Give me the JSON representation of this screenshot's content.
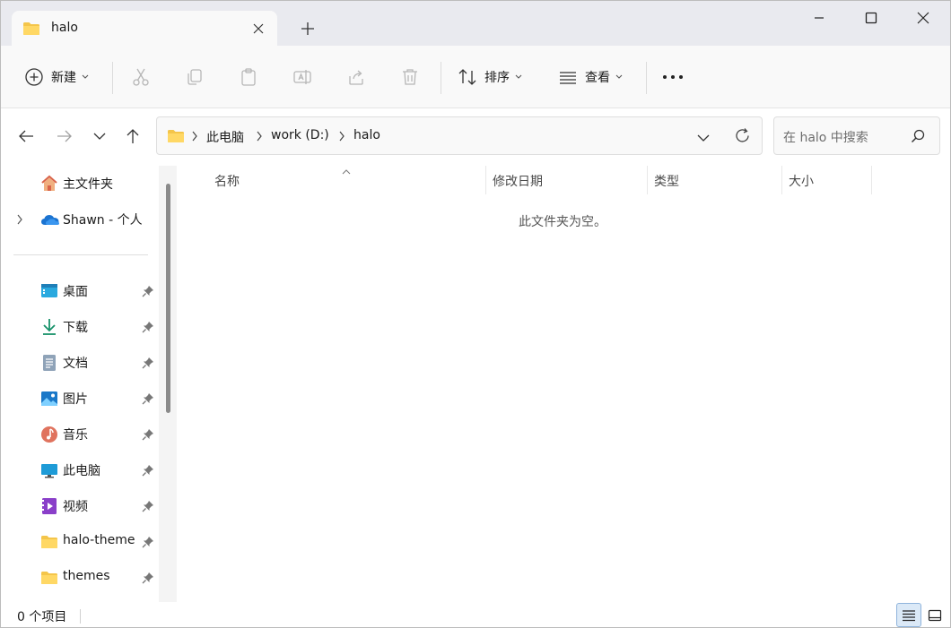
{
  "window": {
    "tab_title": "halo",
    "icons": {
      "tab": "folder-icon",
      "close_tab": "close-icon",
      "new_tab": "plus-icon",
      "minimize": "minimize-icon",
      "maximize": "maximize-icon",
      "close": "close-icon"
    }
  },
  "toolbar": {
    "new_label": "新建",
    "sort_label": "排序",
    "view_label": "查看",
    "icons": [
      "plus-circle-icon",
      "cut-icon",
      "copy-icon",
      "paste-icon",
      "rename-icon",
      "share-icon",
      "delete-icon",
      "sort-icon",
      "view-icon",
      "more-icon"
    ]
  },
  "address": {
    "crumbs": [
      "此电脑",
      "work (D:)",
      "halo"
    ],
    "search_placeholder": "在 halo 中搜索"
  },
  "sidebar": {
    "items": [
      {
        "label": "主文件夹",
        "icon": "home-icon",
        "pinned": false
      },
      {
        "label": "Shawn - 个人",
        "icon": "onedrive-icon",
        "pinned": false,
        "expandable": true
      },
      {
        "label": "桌面",
        "icon": "desktop-icon",
        "pinned": true
      },
      {
        "label": "下载",
        "icon": "download-icon",
        "pinned": true
      },
      {
        "label": "文档",
        "icon": "document-icon",
        "pinned": true
      },
      {
        "label": "图片",
        "icon": "pictures-icon",
        "pinned": true
      },
      {
        "label": "音乐",
        "icon": "music-icon",
        "pinned": true
      },
      {
        "label": "此电脑",
        "icon": "computer-icon",
        "pinned": true
      },
      {
        "label": "视频",
        "icon": "video-icon",
        "pinned": true
      },
      {
        "label": "halo-theme",
        "icon": "folder-icon",
        "pinned": true
      },
      {
        "label": "themes",
        "icon": "folder-icon",
        "pinned": true
      }
    ]
  },
  "content": {
    "columns": [
      "名称",
      "修改日期",
      "类型",
      "大小"
    ],
    "empty_message": "此文件夹为空。"
  },
  "status": {
    "item_count": "0 个项目"
  },
  "colors": {
    "accent": "#0067c0",
    "folder": "#f4c54a",
    "titlebar": "#e9eaef"
  }
}
